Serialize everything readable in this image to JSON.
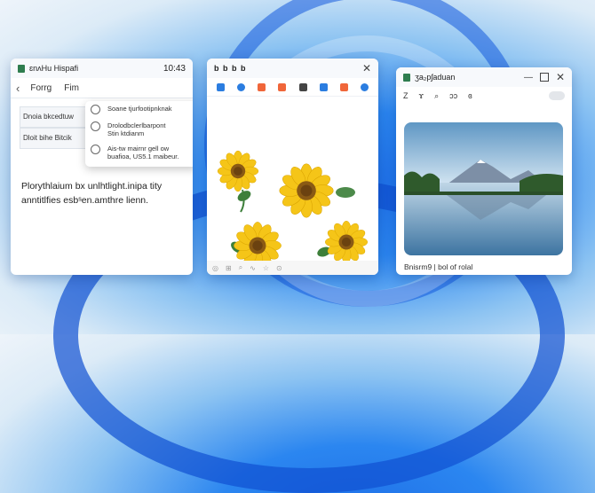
{
  "wallpaper": {
    "accent": "#1e6fe8"
  },
  "notes_window": {
    "title": "ɛnʌHu Hispafi",
    "time": "10:43",
    "nav": {
      "back_icon": "chevron-left-icon",
      "tab1": "Forrg",
      "tab2": "Fim"
    },
    "fields": [
      "Dnoia bkcedtuw",
      "Dloit bihe Bitcik"
    ],
    "dropdown": [
      {
        "icon": "refresh-icon",
        "text": "Soane tjurfootipnknak"
      },
      {
        "icon": "refresh-icon",
        "text": "Drolodbclerlbarpont\nStin ktdianm"
      },
      {
        "icon": "refresh-icon",
        "text": "Ais-tw mairnr gell ow\nbuafioa, US5.1 maibeur."
      }
    ],
    "body": "Plorythlaium bx unlhtlight.inipa tity anntitlfies esbˢen.amthre lienn."
  },
  "flower_window": {
    "title": "b b b b",
    "toolbar": [
      "#2b7de0",
      "#2b7de0",
      "#f0663a",
      "#f0663a",
      "#444444",
      "#2b7de0",
      "#f0663a",
      "#2b7de0"
    ],
    "footer": [
      "◎",
      "⊞",
      "⌕",
      "∿",
      "☆",
      "⊙"
    ]
  },
  "photo_window": {
    "title": "ʒa₂pʃaduan",
    "toolbar": [
      "Z",
      "ɤ",
      "⌕",
      "ɔɔ",
      "ɞ"
    ],
    "caption": "Bnisrm9 | bol of rolal"
  }
}
